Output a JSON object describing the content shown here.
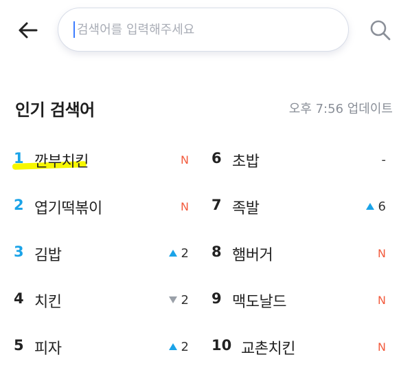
{
  "search": {
    "placeholder": "검색어를 입력해주세요"
  },
  "section": {
    "title": "인기 검색어",
    "update_time": "오후 7:56 업데이트"
  },
  "colors": {
    "accent_blue": "#1aa3e8",
    "new_red": "#f25a3c",
    "highlight_yellow": "#f6f700"
  },
  "ranks": {
    "left": [
      {
        "rank": "1",
        "keyword": "깐부치킨",
        "change": "N"
      },
      {
        "rank": "2",
        "keyword": "엽기떡볶이",
        "change": "N"
      },
      {
        "rank": "3",
        "keyword": "김밥",
        "change": "2",
        "direction": "up"
      },
      {
        "rank": "4",
        "keyword": "치킨",
        "change": "2",
        "direction": "down"
      },
      {
        "rank": "5",
        "keyword": "피자",
        "change": "2",
        "direction": "up"
      }
    ],
    "right": [
      {
        "rank": "6",
        "keyword": "초밥",
        "change": "-"
      },
      {
        "rank": "7",
        "keyword": "족발",
        "change": "6",
        "direction": "up"
      },
      {
        "rank": "8",
        "keyword": "햄버거",
        "change": "N"
      },
      {
        "rank": "9",
        "keyword": "맥도날드",
        "change": "N"
      },
      {
        "rank": "10",
        "keyword": "교촌치킨",
        "change": "N"
      }
    ]
  }
}
